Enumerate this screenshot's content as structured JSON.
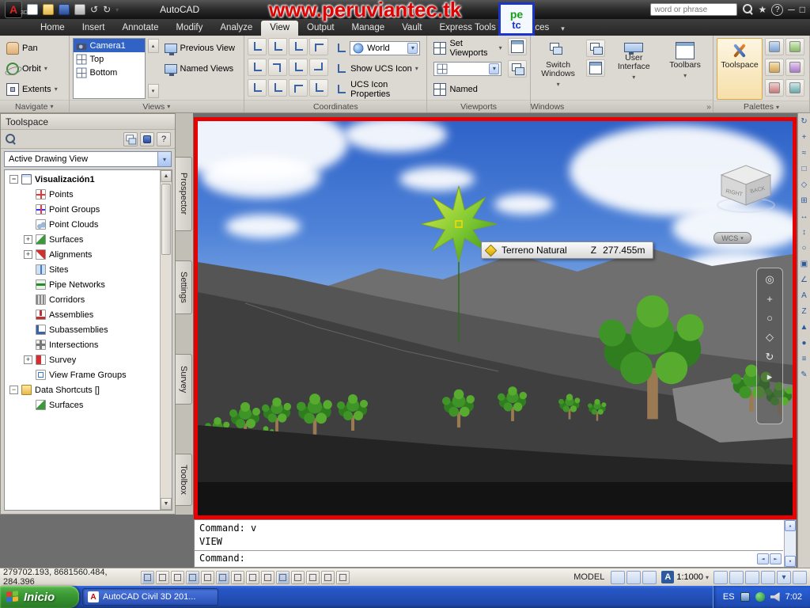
{
  "icons": {
    "chevron_down": "▾",
    "chevron_up": "▴",
    "arrow_up": "▲",
    "arrow_down": "▼",
    "arrow_left": "◄",
    "arrow_right": "►",
    "plus": "+",
    "minus": "−",
    "close": "×",
    "question": "?",
    "double_chevron": "»",
    "star": "★",
    "undo": "↺",
    "redo": "↻",
    "minimize": "─",
    "maximize": "□"
  },
  "titlebar": {
    "app": "AutoCAD",
    "logo_3d": "3D",
    "watermark": "www.peruviantec.tk",
    "search_placeholder": "word or phrase",
    "logo_top": "pe",
    "logo_bottom": "tc"
  },
  "tabs": {
    "items": [
      "Home",
      "Insert",
      "Annotate",
      "Modify",
      "Analyze",
      "View",
      "Output",
      "Manage",
      "Vault",
      "Express Tools",
      "Surfaces"
    ]
  },
  "ribbon": {
    "navigate": {
      "pan": "Pan",
      "orbit": "Orbit",
      "extents": "Extents",
      "label": "Navigate"
    },
    "views": {
      "items": [
        "Camera1",
        "Top",
        "Bottom"
      ],
      "previous": "Previous View",
      "named": "Named Views",
      "label": "Views"
    },
    "coordinates": {
      "world": "World",
      "show_ucs": "Show UCS Icon",
      "ucs_properties": "UCS Icon Properties",
      "label": "Coordinates"
    },
    "viewports": {
      "set_viewports": "Set Viewports",
      "named": "Named",
      "label": "Viewports"
    },
    "windows": {
      "switch_windows": "Switch Windows",
      "user_interface": "User Interface",
      "toolbars": "Toolbars",
      "label": "Windows"
    },
    "palettes": {
      "toolspace": "Toolspace",
      "label": "Palettes"
    }
  },
  "toolspace": {
    "title": "Toolspace",
    "view_selector": "Active Drawing View",
    "tree": [
      {
        "label": "Visualización1"
      },
      {
        "label": "Points"
      },
      {
        "label": "Point Groups"
      },
      {
        "label": "Point Clouds"
      },
      {
        "label": "Surfaces"
      },
      {
        "label": "Alignments"
      },
      {
        "label": "Sites"
      },
      {
        "label": "Pipe Networks"
      },
      {
        "label": "Corridors"
      },
      {
        "label": "Assemblies"
      },
      {
        "label": "Subassemblies"
      },
      {
        "label": "Intersections"
      },
      {
        "label": "Survey"
      },
      {
        "label": "View Frame Groups"
      },
      {
        "label": "Data Shortcuts []"
      },
      {
        "label": "Surfaces"
      }
    ],
    "side_tabs": [
      "Prospector",
      "Settings",
      "Survey",
      "Toolbox"
    ]
  },
  "viewport": {
    "tooltip": {
      "name": "Terreno Natural",
      "axis": "Z",
      "value": "277.455m"
    },
    "wcs": "WCS",
    "cube": {
      "left": "RIGHT",
      "right": "BACK"
    },
    "navbar_glyphs": [
      "◎",
      "+",
      "○",
      "◇",
      "↻",
      "▸"
    ]
  },
  "right_toolbar": {
    "glyphs": [
      "↻",
      "+",
      "≈",
      "□",
      "◇",
      "⊞",
      "↔",
      "↕",
      "○",
      "▣",
      "∠",
      "A",
      "Z",
      "▲",
      "●",
      "≡",
      "✎"
    ]
  },
  "command": {
    "history": [
      "Command: v",
      "VIEW"
    ],
    "prompt": "Command:"
  },
  "status": {
    "coordinates": "279702.193, 8681560.484, 284.396",
    "model_label": "MODEL",
    "annotation_letter": "A",
    "scale": "1:1000"
  },
  "taskbar": {
    "start": "Inicio",
    "task": "AutoCAD Civil 3D 201...",
    "language": "ES",
    "time": "7:02"
  }
}
